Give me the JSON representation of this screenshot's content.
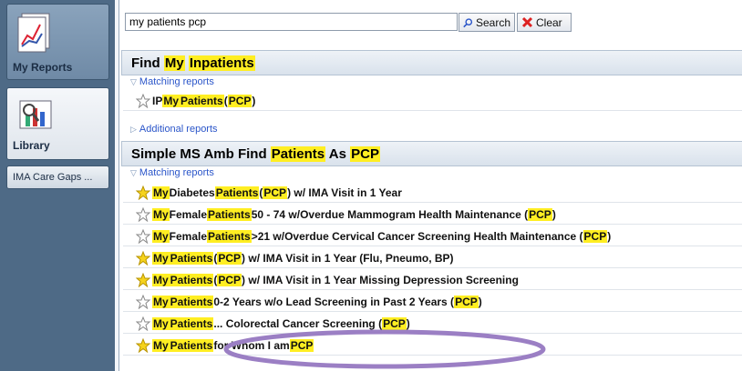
{
  "sidebar": {
    "my_reports": "My Reports",
    "library": "Library",
    "care_gaps": "IMA Care Gaps ..."
  },
  "search": {
    "value": "my patients pcp",
    "search_label": "Search",
    "clear_label": "Clear"
  },
  "groups": [
    {
      "title_parts": [
        [
          "Find ",
          false
        ],
        [
          "My",
          true
        ],
        [
          " ",
          false
        ],
        [
          "Inpatients",
          true
        ]
      ],
      "matching_label": "Matching reports",
      "additional_label": "Additional reports",
      "reports": [
        {
          "parts": [
            [
              "IP ",
              false
            ],
            [
              "My",
              true
            ],
            [
              " ",
              false
            ],
            [
              "Patients",
              true
            ],
            [
              " (",
              false
            ],
            [
              "PCP",
              true
            ],
            [
              ")",
              false
            ]
          ],
          "starred": false
        }
      ]
    },
    {
      "title_parts": [
        [
          "Simple MS Amb Find ",
          false
        ],
        [
          "Patients",
          true
        ],
        [
          " As ",
          false
        ],
        [
          "PCP",
          true
        ]
      ],
      "matching_label": "Matching reports",
      "reports": [
        {
          "parts": [
            [
              "My",
              true
            ],
            [
              " Diabetes ",
              false
            ],
            [
              "Patients",
              true
            ],
            [
              " (",
              false
            ],
            [
              "PCP",
              true
            ],
            [
              ") w/ IMA Visit in 1 Year",
              false
            ]
          ],
          "starred": true
        },
        {
          "parts": [
            [
              "My",
              true
            ],
            [
              " Female ",
              false
            ],
            [
              "Patients",
              true
            ],
            [
              " 50 - 74 w/Overdue Mammogram Health Maintenance (",
              false
            ],
            [
              "PCP",
              true
            ],
            [
              ")",
              false
            ]
          ],
          "starred": false
        },
        {
          "parts": [
            [
              "My",
              true
            ],
            [
              " Female ",
              false
            ],
            [
              "Patients",
              true
            ],
            [
              " >21 w/Overdue Cervical Cancer Screening Health Maintenance (",
              false
            ],
            [
              "PCP",
              true
            ],
            [
              ")",
              false
            ]
          ],
          "starred": false
        },
        {
          "parts": [
            [
              "My",
              true
            ],
            [
              " ",
              false
            ],
            [
              "Patients",
              true
            ],
            [
              " (",
              false
            ],
            [
              "PCP",
              true
            ],
            [
              ") w/ IMA Visit in 1 Year (Flu, Pneumo, BP)",
              false
            ]
          ],
          "starred": true
        },
        {
          "parts": [
            [
              "My",
              true
            ],
            [
              " ",
              false
            ],
            [
              "Patients",
              true
            ],
            [
              " (",
              false
            ],
            [
              "PCP",
              true
            ],
            [
              ") w/ IMA Visit in 1 Year Missing Depression Screening",
              false
            ]
          ],
          "starred": true
        },
        {
          "parts": [
            [
              "My",
              true
            ],
            [
              " ",
              false
            ],
            [
              "Patients",
              true
            ],
            [
              " 0-2 Years w/o Lead Screening in Past 2 Years (",
              false
            ],
            [
              "PCP",
              true
            ],
            [
              ")",
              false
            ]
          ],
          "starred": false
        },
        {
          "parts": [
            [
              "My",
              true
            ],
            [
              " ",
              false
            ],
            [
              "Patients",
              true
            ],
            [
              " ... Colorectal Cancer Screening (",
              false
            ],
            [
              "PCP",
              true
            ],
            [
              ")",
              false
            ]
          ],
          "starred": false
        },
        {
          "parts": [
            [
              "My",
              true
            ],
            [
              " ",
              false
            ],
            [
              "Patients",
              true
            ],
            [
              " for Whom I am ",
              false
            ],
            [
              "PCP",
              true
            ]
          ],
          "starred": true
        }
      ]
    }
  ],
  "colors": {
    "highlight": "#ffee22",
    "link": "#2a55c9",
    "sidebar": "#4e6a86",
    "ellipse": "#9b7fc4"
  }
}
